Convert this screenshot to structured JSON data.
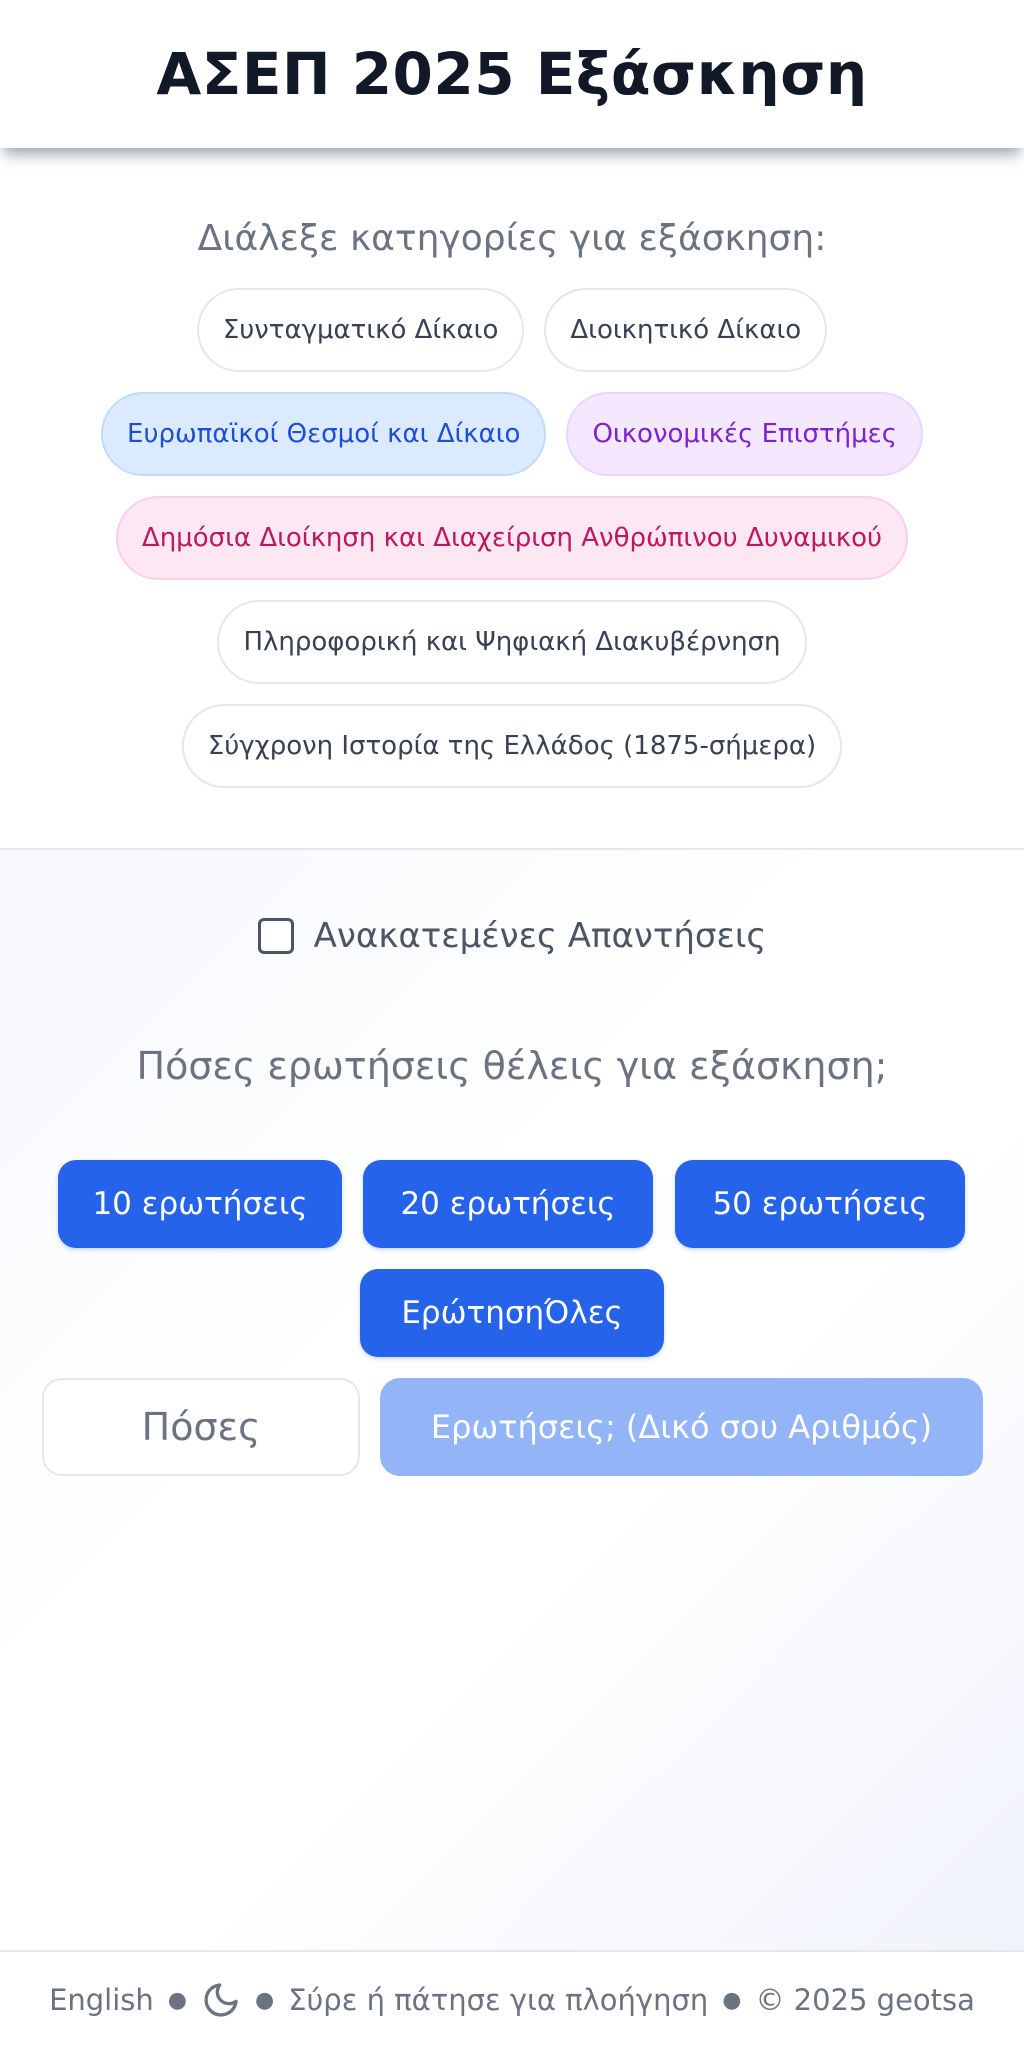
{
  "header": {
    "title": "ΑΣΕΠ 2025 Εξάσκηση"
  },
  "categories": {
    "title": "Διάλεξε κατηγορίες για εξάσκηση:",
    "items": [
      {
        "label": "Συνταγματικό Δίκαιο",
        "selected": false
      },
      {
        "label": "Διοικητικό Δίκαιο",
        "selected": false
      },
      {
        "label": "Ευρωπαϊκοί Θεσμοί και Δίκαιο",
        "selected": true,
        "color": "#dbeafe"
      },
      {
        "label": "Οικονομικές Επιστήμες",
        "selected": true,
        "color": "#f3e8ff"
      },
      {
        "label": "Δημόσια Διοίκηση και Διαχείριση Ανθρώπινου Δυναμικού",
        "selected": true,
        "color": "#fce7f3"
      },
      {
        "label": "Πληροφορική και Ψηφιακή Διακυβέρνηση",
        "selected": false
      },
      {
        "label": "Σύγχρονη Ιστορία της Ελλάδος (1875-σήμερα)",
        "selected": false
      }
    ]
  },
  "shuffle": {
    "label": "Ανακατεμένες Απαντήσεις",
    "checked": false
  },
  "questions": {
    "title": "Πόσες ερωτήσεις θέλεις για εξάσκηση;",
    "buttons": [
      "10 ερωτήσεις",
      "20 ερωτήσεις",
      "50 ερωτήσεις",
      "ΕρώτησηΌλες"
    ],
    "custom_placeholder": "Πόσες",
    "custom_button": "Ερωτήσεις; (Δικό σου Αριθμός)"
  },
  "footer": {
    "language": "English",
    "hint": "Σύρε ή πάτησε για πλοήγηση",
    "copyright": "© 2025 geotsa"
  },
  "colors": {
    "primary": "#2563eb",
    "primary_disabled": "#93b4f6"
  }
}
